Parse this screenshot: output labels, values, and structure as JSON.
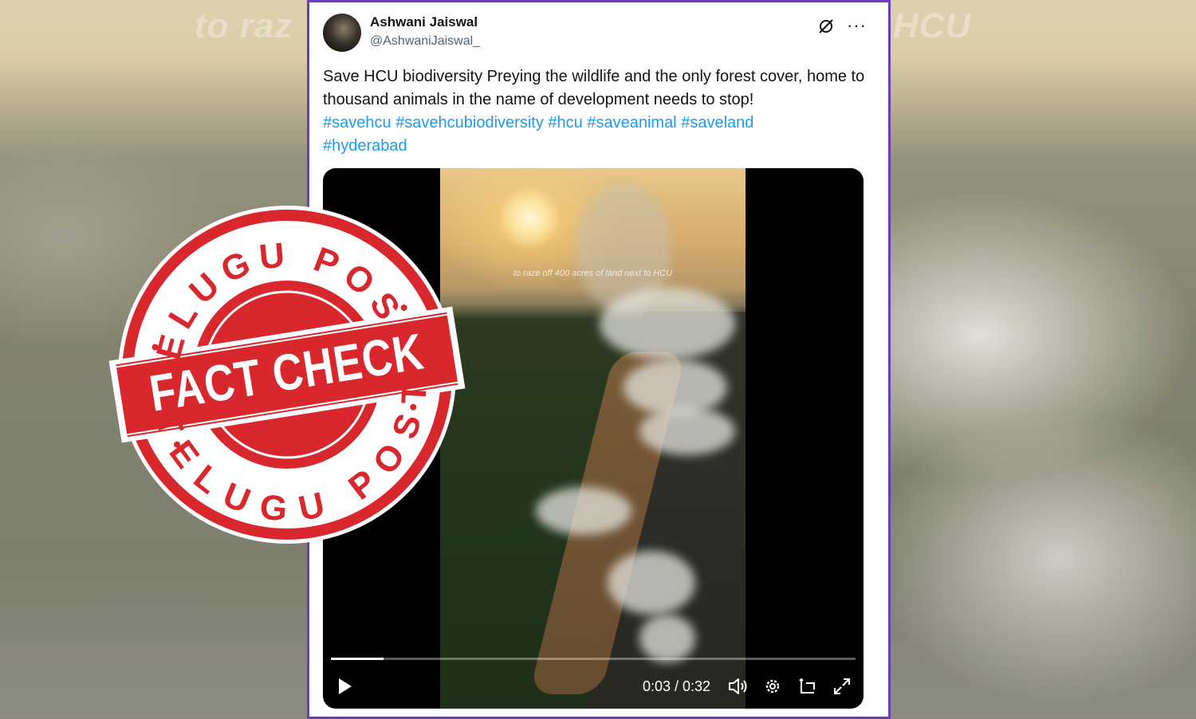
{
  "background": {
    "overlay_text_left": "to raz",
    "overlay_text_right": "HCU"
  },
  "stamp": {
    "top_text": "TELUGU POST",
    "center_text": "FACT CHECK",
    "bottom_text": "TELUGU POST",
    "color": "#d8282e"
  },
  "tweet": {
    "author_name": "Ashwani Jaiswal",
    "author_handle": "@AshwaniJaiswal_",
    "text_line": "Save HCU biodiversity   Preying the wildlife and the only forest cover, home to thousand animals in the name of development needs to stop!",
    "hashtags": [
      "#savehcu",
      "#savehcubiodiversity",
      "#hcu",
      "#saveanimal",
      "#saveland",
      "#hyderabad"
    ],
    "header_icons": [
      "grok-icon",
      "more-options-icon"
    ]
  },
  "video": {
    "caption": "to raze off 400 acres of land next to HCU",
    "current_time": "0:03",
    "duration": "0:32",
    "time_display": "0:03 / 0:32",
    "progress_fraction": 0.1,
    "controls": [
      "play-icon",
      "volume-icon",
      "settings-gear-icon",
      "picture-in-picture-icon",
      "fullscreen-icon"
    ]
  },
  "colors": {
    "frame_border": "#6a3fb5",
    "hashtag": "#1d9bf0",
    "text": "#0f1419",
    "handle": "#536471"
  }
}
